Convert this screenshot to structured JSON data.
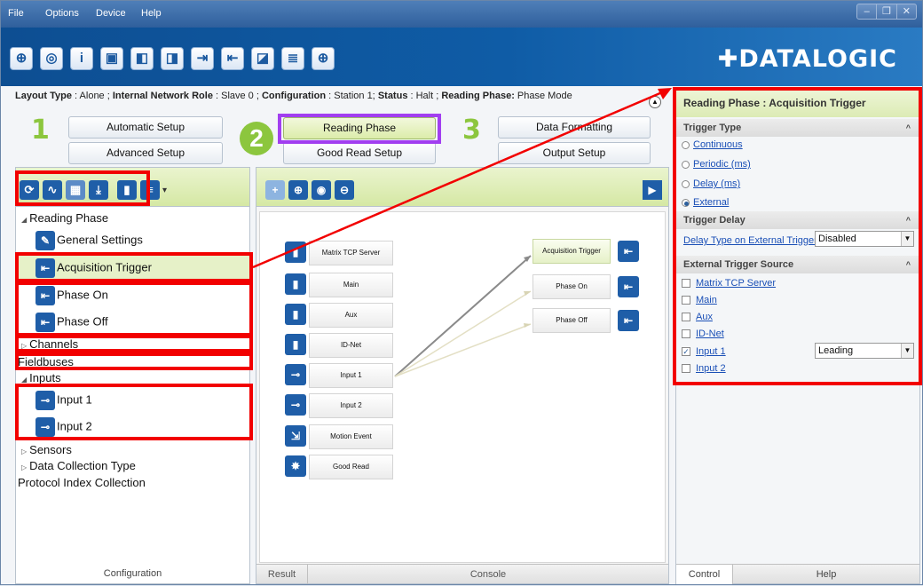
{
  "menu": [
    "File",
    "Options",
    "Device",
    "Help"
  ],
  "window_buttons": [
    "–",
    "❐",
    "✕"
  ],
  "brand": "✚DATALOGIC",
  "status": {
    "layout_type_label": "Layout Type",
    "layout_type_value": " : Alone ;",
    "network_role_label": "Internal Network Role",
    "network_role_value": " : Slave 0 ;",
    "configuration_label": "Configuration",
    "configuration_value": " : Station 1;",
    "status_label": "Status",
    "status_value": " : Halt ;",
    "reading_phase_label": "Reading Phase:",
    "reading_phase_value": " Phase Mode"
  },
  "steps": {
    "num1": "1",
    "num2": "2",
    "num3": "3",
    "automatic_setup": "Automatic Setup",
    "advanced_setup": "Advanced Setup",
    "reading_phase": "Reading Phase",
    "good_read_setup": "Good Read Setup",
    "data_formatting": "Data Formatting",
    "output_setup": "Output Setup"
  },
  "tree": {
    "reading_phase": "Reading Phase",
    "general_settings": "General Settings",
    "acquisition_trigger": "Acquisition Trigger",
    "phase_on": "Phase On",
    "phase_off": "Phase Off",
    "channels": "Channels",
    "fieldbuses": "Fieldbuses",
    "inputs": "Inputs",
    "input1": "Input 1",
    "input2": "Input 2",
    "sensors": "Sensors",
    "data_collection_type": "Data Collection Type",
    "protocol_index_collection": "Protocol Index Collection",
    "footer": "Configuration"
  },
  "canvas": {
    "nodes_left": [
      "Matrix TCP Server",
      "Main",
      "Aux",
      "ID-Net",
      "Input 1",
      "Input 2",
      "Motion Event",
      "Good Read"
    ],
    "nodes_right": [
      "Acquisition Trigger",
      "Phase On",
      "Phase Off"
    ],
    "tab_result": "Result",
    "tab_console": "Console"
  },
  "panel": {
    "title": "Reading Phase : Acquisition Trigger",
    "trigger_type": "Trigger Type",
    "opt_continuous": "Continuous",
    "opt_periodic": "Periodic (ms)",
    "opt_delay": "Delay (ms)",
    "opt_external": "External",
    "trigger_delay": "Trigger Delay",
    "delay_type_label": "Delay Type on External Trigger",
    "delay_type_value": "Disabled",
    "ext_source": "External Trigger Source",
    "src": [
      "Matrix TCP Server",
      "Main",
      "Aux",
      "ID-Net",
      "Input 1",
      "Input 2"
    ],
    "input1_edge": "Leading",
    "tab_control": "Control",
    "tab_help": "Help"
  },
  "colors": {
    "highlight_red": "#f20000",
    "highlight_purple": "#a23ef0",
    "accent_green": "#8cc63e",
    "toolbar_blue": "#0d4e92"
  }
}
